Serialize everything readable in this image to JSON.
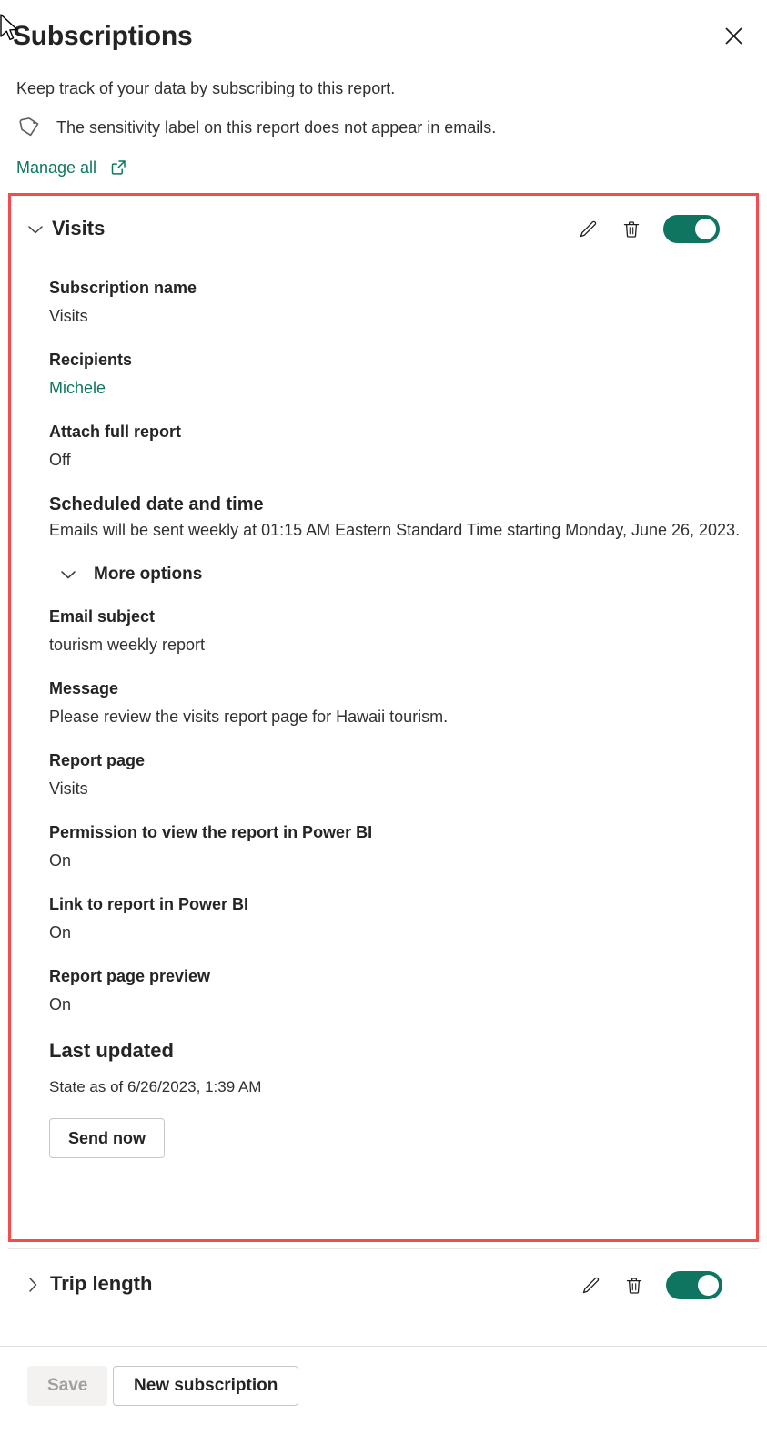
{
  "header": {
    "title": "Subscriptions",
    "close_icon": "close-icon",
    "subtitle": "Keep track of your data by subscribing to this report.",
    "sensitivity_icon": "tag-icon",
    "sensitivity_note": "The sensitivity label on this report does not appear in emails.",
    "manage_all_label": "Manage all",
    "manage_all_icon": "external-link-icon"
  },
  "subscriptions": [
    {
      "name": "Visits",
      "expanded": true,
      "expand_icon": "chevron-down-icon",
      "edit_icon": "pencil-icon",
      "delete_icon": "trash-icon",
      "toggle_icon": "toggle-on",
      "toggle_state": "On",
      "fields": [
        {
          "label": "Subscription name",
          "value": "Visits"
        },
        {
          "label": "Recipients",
          "value": "Michele",
          "is_link": true
        },
        {
          "label": "Attach full report",
          "value": "Off"
        }
      ],
      "schedule": {
        "label": "Scheduled date and time",
        "value": "Emails will be sent weekly at 01:15 AM Eastern Standard Time starting Monday, June 26, 2023."
      },
      "more_options": {
        "label": "More options",
        "icon": "chevron-down-icon",
        "expanded": true,
        "fields": [
          {
            "label": "Email subject",
            "value": "tourism weekly report"
          },
          {
            "label": "Message",
            "value": "Please review the visits report page for Hawaii tourism."
          },
          {
            "label": "Report page",
            "value": "Visits"
          },
          {
            "label": "Permission to view the report in Power BI",
            "value": "On"
          },
          {
            "label": "Link to report in Power BI",
            "value": "On"
          },
          {
            "label": "Report page preview",
            "value": "On"
          }
        ]
      },
      "last_updated": {
        "label": "Last updated",
        "value": "State as of 6/26/2023, 1:39 AM"
      },
      "send_now_label": "Send now"
    },
    {
      "name": "Trip length",
      "expanded": false,
      "expand_icon": "chevron-right-icon",
      "edit_icon": "pencil-icon",
      "delete_icon": "trash-icon",
      "toggle_icon": "toggle-on",
      "toggle_state": "On"
    }
  ],
  "footer": {
    "save_label": "Save",
    "save_disabled": true,
    "new_subscription_label": "New subscription"
  },
  "colors": {
    "accent_teal": "#0f7561",
    "highlight_red": "#f64b4b",
    "text_primary": "#242424",
    "text_secondary": "#323130",
    "disabled_text": "#a19f9d"
  }
}
